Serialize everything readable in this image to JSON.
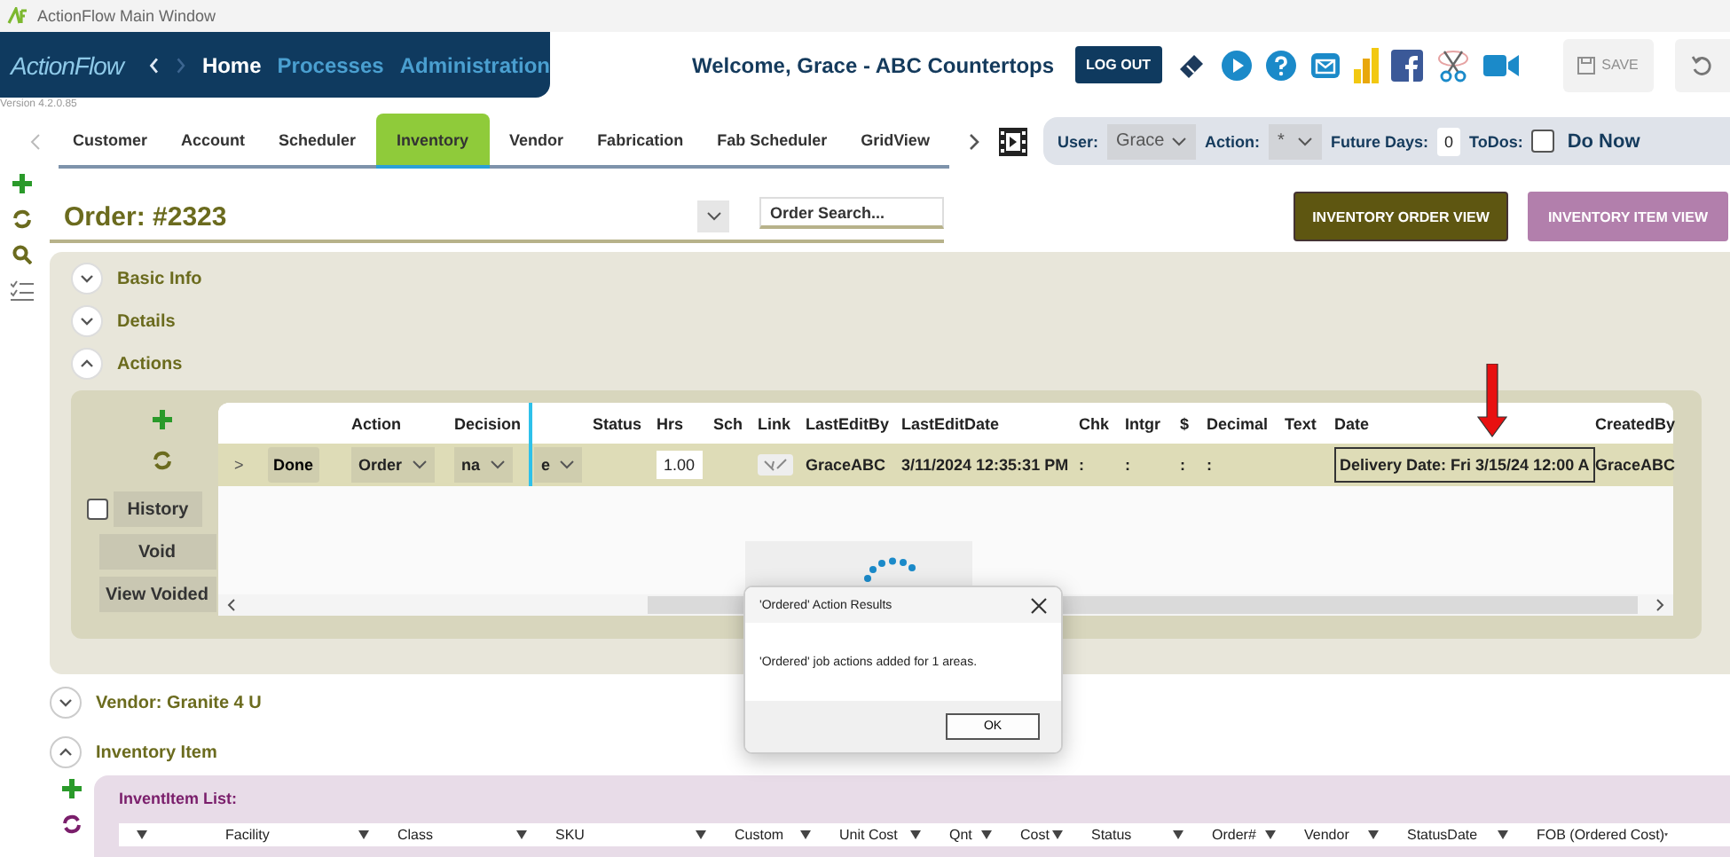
{
  "window": {
    "title": "ActionFlow Main Window"
  },
  "header": {
    "logo": "ActionFlow",
    "nav": [
      {
        "label": "Home",
        "selected": true
      },
      {
        "label": "Processes",
        "selected": false
      },
      {
        "label": "Administration",
        "selected": false
      }
    ],
    "welcome": "Welcome, Grace - ABC Countertops",
    "logout": "LOG OUT",
    "save": {
      "label": "SAVE",
      "disabled": true
    },
    "version": "Version 4.2.0.85"
  },
  "tabs": [
    {
      "label": "Customer",
      "selected": false
    },
    {
      "label": "Account",
      "selected": false
    },
    {
      "label": "Scheduler",
      "selected": false
    },
    {
      "label": "Inventory",
      "selected": true
    },
    {
      "label": "Vendor",
      "selected": false
    },
    {
      "label": "Fabrication",
      "selected": false
    },
    {
      "label": "Fab Scheduler",
      "selected": false
    },
    {
      "label": "GridView",
      "selected": false
    }
  ],
  "filters": {
    "user_label": "User:",
    "user": "Grace",
    "action_label": "Action:",
    "action": "*",
    "future_label": "Future Days:",
    "future": "0",
    "todos_label": "ToDos:",
    "todos_checked": false,
    "do_now": "Do Now"
  },
  "order": {
    "title": "Order:  #2323",
    "search_placeholder": "Order Search...",
    "buttons": [
      {
        "label": "INVENTORY ORDER VIEW",
        "kind": "order"
      },
      {
        "label": "INVENTORY ITEM VIEW",
        "kind": "item"
      }
    ]
  },
  "sections": [
    {
      "label": "Basic Info",
      "expanded": false
    },
    {
      "label": "Details",
      "expanded": false
    },
    {
      "label": "Actions",
      "expanded": true
    }
  ],
  "actions": {
    "history": {
      "label": "History",
      "checked": false
    },
    "buttons": [
      "Void",
      "View Voided"
    ],
    "columns": [
      null,
      null,
      "Action",
      "Decision",
      null,
      "Status",
      "Hrs",
      "Sch",
      "Link",
      "LastEditBy",
      "LastEditDate",
      "Chk",
      "Intgr",
      "$",
      "Decimal",
      "Text",
      "Date",
      "CreatedBy"
    ],
    "row": [
      {
        "kind": "expander",
        "text": ">"
      },
      {
        "kind": "button",
        "text": "Done"
      },
      {
        "kind": "dropdown",
        "text": "Order"
      },
      {
        "kind": "dropdown",
        "text": "na"
      },
      {
        "kind": "dropdown",
        "text": "e"
      },
      {
        "kind": "empty"
      },
      {
        "kind": "input",
        "text": "1.00"
      },
      {
        "kind": "empty"
      },
      {
        "kind": "link"
      },
      {
        "kind": "text",
        "text": "GraceABC"
      },
      {
        "kind": "text",
        "text": "3/11/2024 12:35:31 PM"
      },
      {
        "kind": "text",
        "text": ":"
      },
      {
        "kind": "text",
        "text": ":"
      },
      {
        "kind": "text",
        "text": ":"
      },
      {
        "kind": "text",
        "text": ":"
      },
      {
        "kind": "empty"
      },
      {
        "kind": "boxed",
        "text": "Delivery Date: Fri 3/15/24 12:00 A"
      },
      {
        "kind": "text",
        "text": "GraceABC"
      }
    ]
  },
  "lower_sections": [
    {
      "label": "Vendor: Granite 4 U",
      "expanded": false
    },
    {
      "label": "Inventory Item",
      "expanded": true
    }
  ],
  "invent_list": {
    "title": "InventItem List:",
    "columns": [
      null,
      "Facility",
      "Class",
      "SKU",
      "Custom",
      "Unit Cost",
      "Qnt",
      "Cost",
      "Status",
      "Order#",
      "Vendor",
      "StatusDate",
      "FOB (Ordered Cost)"
    ]
  },
  "dialog": {
    "title": "'Ordered' Action Results",
    "message": "'Ordered' job actions added for 1 areas.",
    "ok": "OK"
  }
}
